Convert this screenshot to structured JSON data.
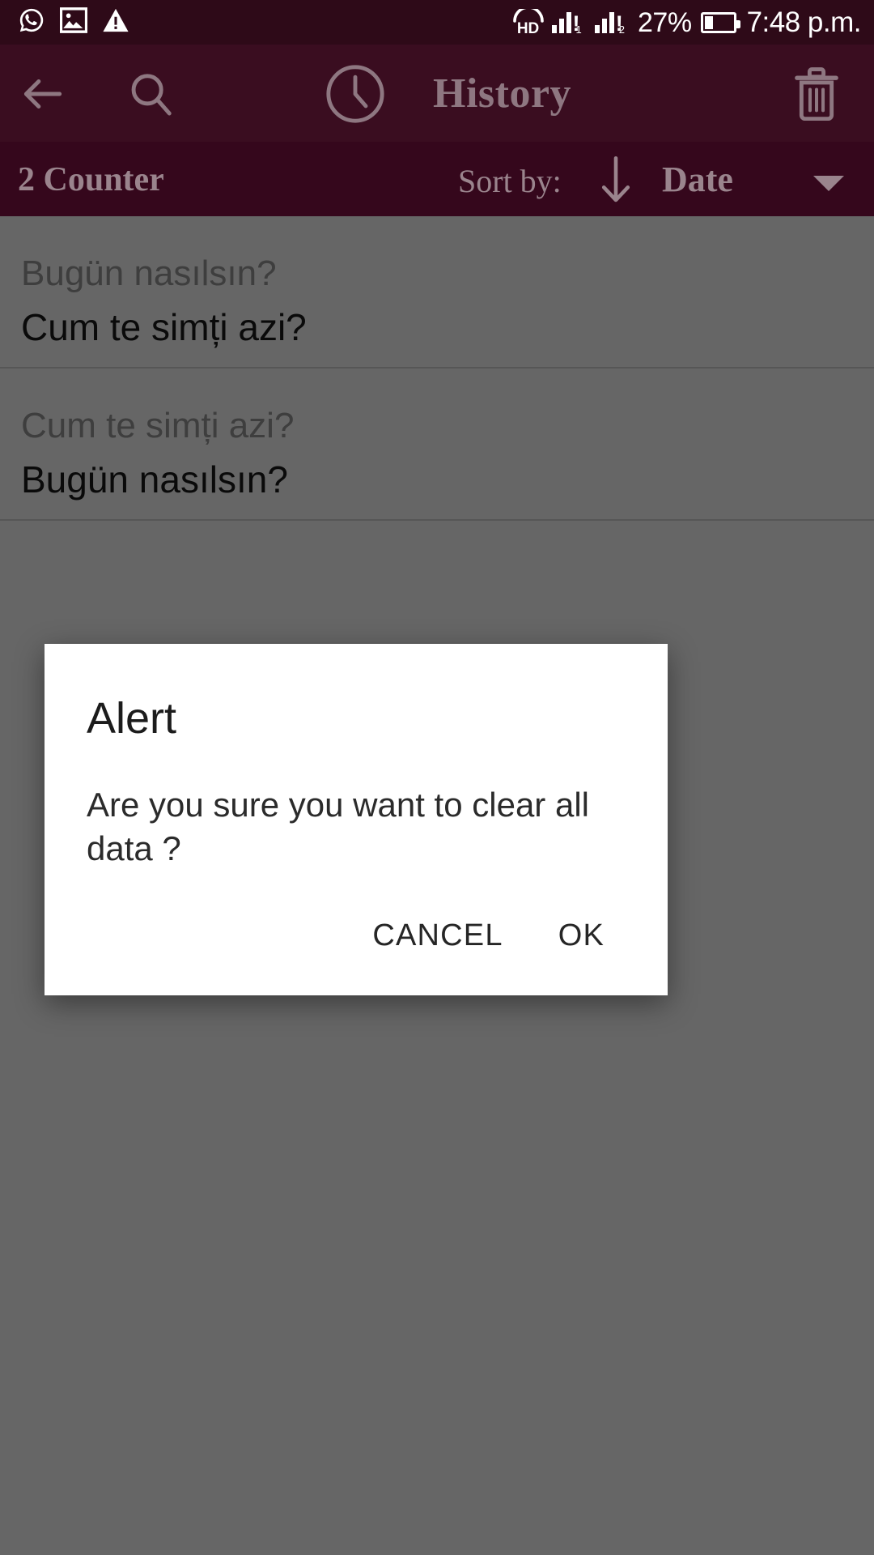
{
  "statusbar": {
    "left_icons": [
      {
        "name": "whatsapp-icon",
        "glyph": "whatsapp"
      },
      {
        "name": "image-icon",
        "glyph": "picture"
      },
      {
        "name": "warning-icon",
        "glyph": "triangle-exclamation"
      }
    ],
    "volte_label": "HD",
    "signal_1_label": "!",
    "signal_1_sub": "1",
    "signal_2_label": "!",
    "signal_2_sub": "2",
    "battery_percent": "27%",
    "battery_level": 27,
    "time": "7:48 p.m.",
    "background_color": "#2e0a18",
    "text_color": "#ffffff"
  },
  "toolbar": {
    "back_icon": "arrow-left-icon",
    "search_icon": "search-icon",
    "clock_icon": "clock-icon",
    "title": "History",
    "delete_icon": "trash-icon",
    "background_color": "#3a0d20",
    "foreground_color": "#8e7781"
  },
  "sortbar": {
    "counter_label": "2 Counter",
    "sort_by_label": "Sort by:",
    "sort_direction_icon": "arrow-down-icon",
    "sort_field": "Date",
    "caret_icon": "caret-down-icon",
    "background_color": "#35071c",
    "foreground_color": "#9a848d"
  },
  "history": {
    "items": [
      {
        "source": "Bugün nasılsın?",
        "target": "Cum te simți azi?"
      },
      {
        "source": "Cum te simți azi?",
        "target": "Bugün nasılsın?"
      }
    ]
  },
  "dialog": {
    "title": "Alert",
    "message": "Are you sure you want to clear all data ?",
    "cancel_label": "CANCEL",
    "ok_label": "OK",
    "background_color": "#ffffff"
  }
}
